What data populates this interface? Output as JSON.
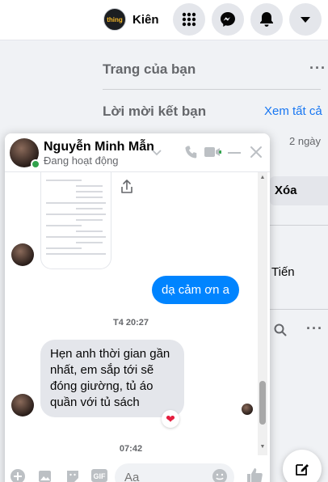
{
  "topbar": {
    "profile_name": "Kiên",
    "profile_logo_text": "thing"
  },
  "sidebar": {
    "your_pages_title": "Trang của bạn",
    "friend_requests_title": "Lời mời kết bạn",
    "see_all_label": "Xem tất cả",
    "request_time": "2 ngày",
    "delete_label": "Xóa",
    "partial_name": "Tiến"
  },
  "chat": {
    "contact_name": "Nguyễn Minh Mẫn",
    "contact_status": "Đang hoạt động",
    "messages": [
      {
        "direction": "out",
        "text": "dạ cảm ơn a"
      },
      {
        "direction": "in",
        "text": "Hẹn anh thời gian gần nhất, em sắp tới sẽ đóng giường, tủ áo quần với tủ sách"
      }
    ],
    "timestamps": [
      "T4 20:27",
      "07:42"
    ],
    "reaction": "❤",
    "composer_placeholder": "Aa"
  },
  "colors": {
    "accent": "#1877f2",
    "outgoing_bubble": "#0084ff",
    "incoming_bubble": "#e4e6eb",
    "online": "#31a24c"
  }
}
